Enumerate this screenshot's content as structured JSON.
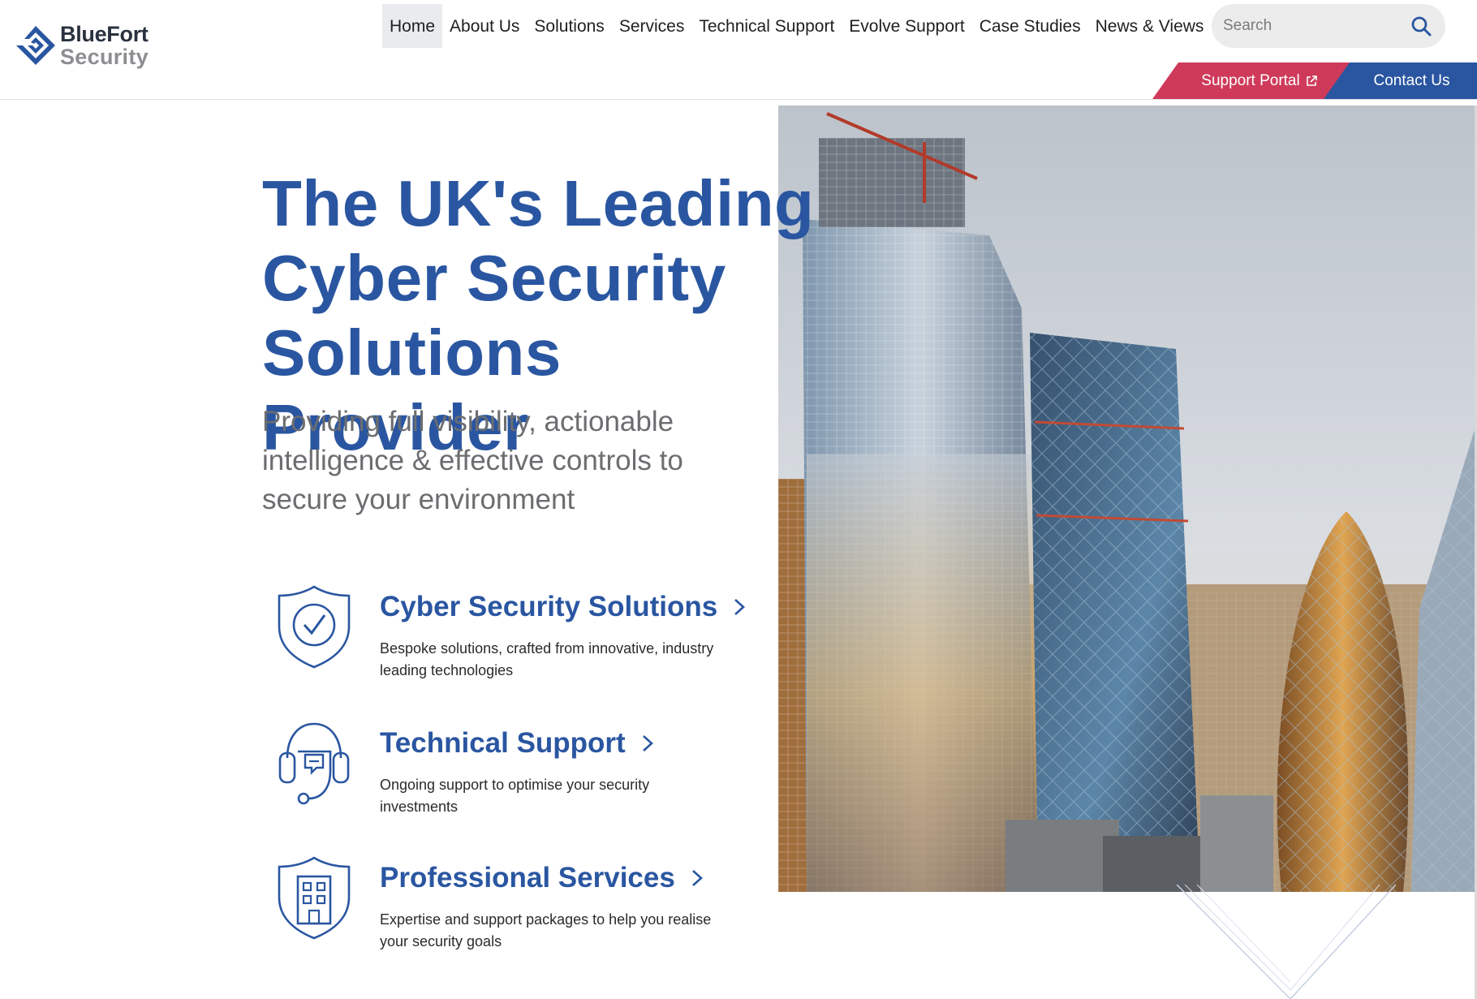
{
  "brand": {
    "name_line1": "BlueFort",
    "name_line2": "Security",
    "primary_color": "#2a56a1",
    "accent_color": "#cf3a5a"
  },
  "nav": {
    "items": [
      {
        "label": "Home",
        "active": true
      },
      {
        "label": "About Us"
      },
      {
        "label": "Solutions"
      },
      {
        "label": "Services"
      },
      {
        "label": "Technical Support"
      },
      {
        "label": "Evolve Support"
      },
      {
        "label": "Case Studies"
      },
      {
        "label": "News & Views"
      }
    ]
  },
  "search": {
    "placeholder": "Search",
    "icon": "search-icon"
  },
  "header_actions": {
    "support_portal": "Support Portal",
    "support_portal_icon": "external-link-icon",
    "contact_us": "Contact Us"
  },
  "hero": {
    "title": "The UK's Leading Cyber Security Solutions Provider",
    "subtitle": "Providing full visibility, actionable intelligence & effective controls to secure your environment",
    "image_subject": "London city skyline skyscrapers"
  },
  "features": [
    {
      "icon": "shield-check-icon",
      "title": "Cyber Security Solutions",
      "description": "Bespoke solutions, crafted from innovative, industry leading technologies"
    },
    {
      "icon": "headset-icon",
      "title": "Technical Support",
      "description": "Ongoing support to optimise your security investments"
    },
    {
      "icon": "shield-building-icon",
      "title": "Professional Services",
      "description": "Expertise and support packages to help you realise your security goals"
    }
  ]
}
